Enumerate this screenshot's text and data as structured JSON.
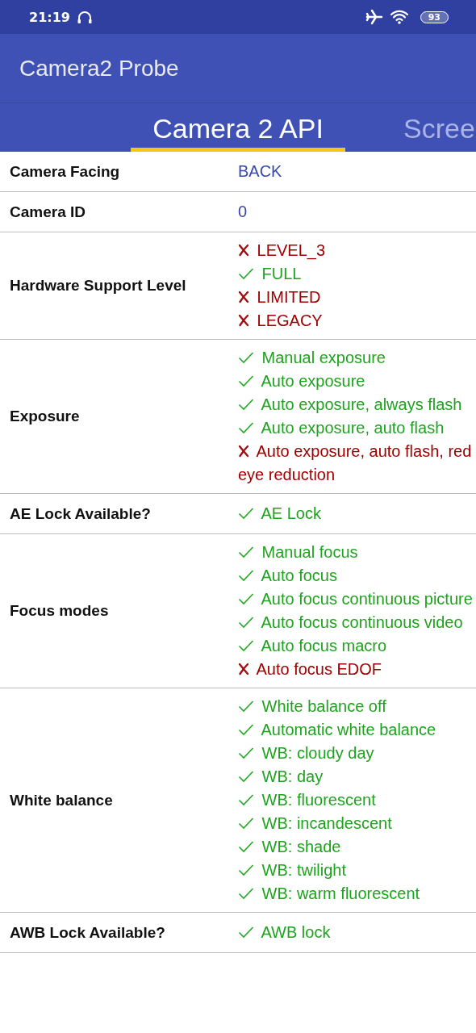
{
  "status_bar": {
    "time": "21:19",
    "battery": "93"
  },
  "app_bar": {
    "title": "Camera2 Probe"
  },
  "tabs": [
    {
      "label": "Camera 2 API",
      "selected": true
    },
    {
      "label": "Scree",
      "selected": false
    }
  ],
  "rows": [
    {
      "label": "Camera Facing",
      "kind": "text",
      "value": "BACK"
    },
    {
      "label": "Camera ID",
      "kind": "text",
      "value": "0"
    },
    {
      "label": "Hardware Support Level",
      "kind": "features",
      "features": [
        {
          "label": "LEVEL_3",
          "supported": false
        },
        {
          "label": "FULL",
          "supported": true
        },
        {
          "label": "LIMITED",
          "supported": false
        },
        {
          "label": "LEGACY",
          "supported": false
        }
      ]
    },
    {
      "label": "Exposure",
      "kind": "features",
      "features": [
        {
          "label": "Manual exposure",
          "supported": true
        },
        {
          "label": "Auto exposure",
          "supported": true
        },
        {
          "label": "Auto exposure, always flash",
          "supported": true
        },
        {
          "label": "Auto exposure, auto flash",
          "supported": true
        },
        {
          "label": "Auto exposure, auto flash, red eye reduction",
          "supported": false
        }
      ]
    },
    {
      "label": "AE Lock Available?",
      "kind": "features",
      "features": [
        {
          "label": "AE Lock",
          "supported": true
        }
      ]
    },
    {
      "label": "Focus modes",
      "kind": "features",
      "features": [
        {
          "label": "Manual focus",
          "supported": true
        },
        {
          "label": "Auto focus",
          "supported": true
        },
        {
          "label": "Auto focus continuous picture",
          "supported": true
        },
        {
          "label": "Auto focus continuous video",
          "supported": true
        },
        {
          "label": "Auto focus macro",
          "supported": true
        },
        {
          "label": "Auto focus EDOF",
          "supported": false
        }
      ]
    },
    {
      "label": "White balance",
      "kind": "features",
      "features": [
        {
          "label": "White balance off",
          "supported": true
        },
        {
          "label": "Automatic white balance",
          "supported": true
        },
        {
          "label": "WB: cloudy day",
          "supported": true
        },
        {
          "label": "WB: day",
          "supported": true
        },
        {
          "label": "WB: fluorescent",
          "supported": true
        },
        {
          "label": "WB: incandescent",
          "supported": true
        },
        {
          "label": "WB: shade",
          "supported": true
        },
        {
          "label": "WB: twilight",
          "supported": true
        },
        {
          "label": "WB: warm fluorescent",
          "supported": true
        }
      ]
    },
    {
      "label": "AWB Lock Available?",
      "kind": "features",
      "features": [
        {
          "label": "AWB lock",
          "supported": true
        }
      ]
    }
  ]
}
